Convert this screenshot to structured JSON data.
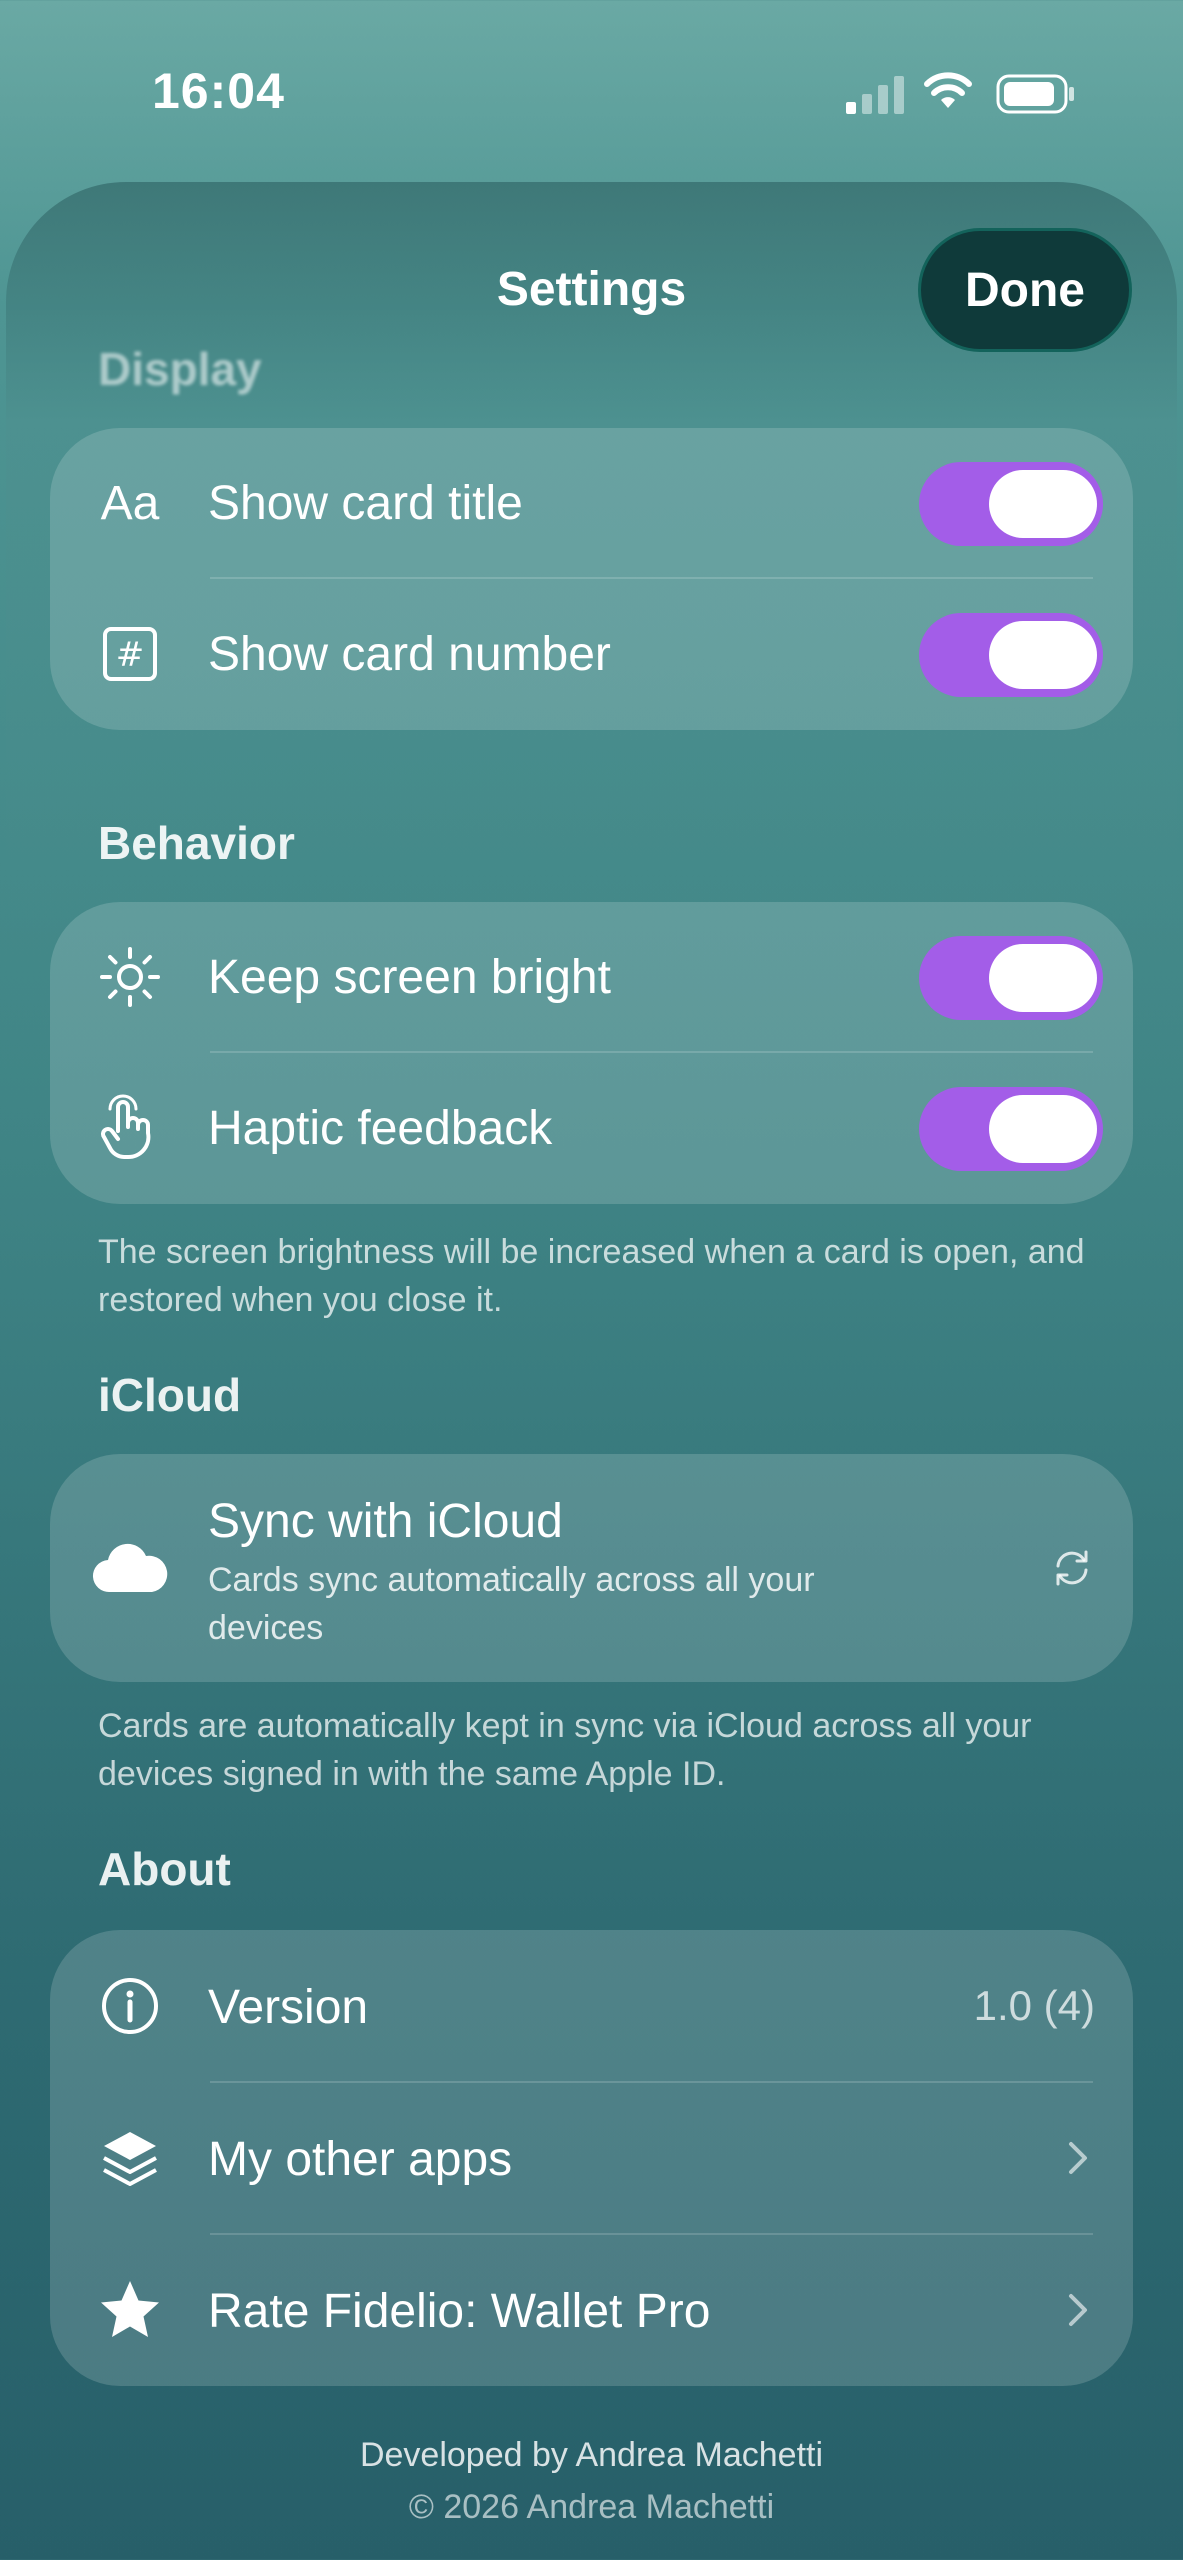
{
  "status_bar": {
    "time": "16:04",
    "icons": [
      "cellular-signal-icon",
      "wifi-icon",
      "battery-icon"
    ]
  },
  "header": {
    "title": "Settings",
    "done_label": "Done"
  },
  "sections": {
    "display": {
      "header": "Display",
      "rows": [
        {
          "icon": "text-format-icon",
          "icon_text": "Aa",
          "label": "Show card title",
          "toggle_on": true
        },
        {
          "icon": "number-sign-icon",
          "icon_text": "#",
          "label": "Show card number",
          "toggle_on": true
        }
      ]
    },
    "behavior": {
      "header": "Behavior",
      "rows": [
        {
          "icon": "sun-icon",
          "label": "Keep screen bright",
          "toggle_on": true
        },
        {
          "icon": "hand-tap-icon",
          "label": "Haptic feedback",
          "toggle_on": true
        }
      ],
      "footnote": "The screen brightness will be increased when a card is open, and restored when you close it."
    },
    "icloud": {
      "header": "iCloud",
      "row": {
        "icon": "cloud-icon",
        "label": "Sync with iCloud",
        "subtitle": "Cards sync automatically across all your devices",
        "status_icon": "sync-arrows-icon"
      },
      "footnote": "Cards are automatically kept in sync via iCloud across all your devices signed in with the same Apple ID."
    },
    "about": {
      "header": "About",
      "rows": [
        {
          "icon": "info-icon",
          "label": "Version",
          "value": "1.0 (4)"
        },
        {
          "icon": "layers-icon",
          "label": "My other apps",
          "accessory": "chevron-right-icon"
        },
        {
          "icon": "star-icon",
          "label": "Rate Fidelio: Wallet Pro",
          "accessory": "chevron-right-icon"
        }
      ]
    }
  },
  "footer": {
    "developer": "Developed by Andrea Machetti",
    "copyright": "© 2026 Andrea Machetti"
  },
  "colors": {
    "toggle_on": "#a35de8",
    "done_button": "#0f3a3a",
    "background_top": "#6aa9a4",
    "background_bottom": "#275f69"
  }
}
